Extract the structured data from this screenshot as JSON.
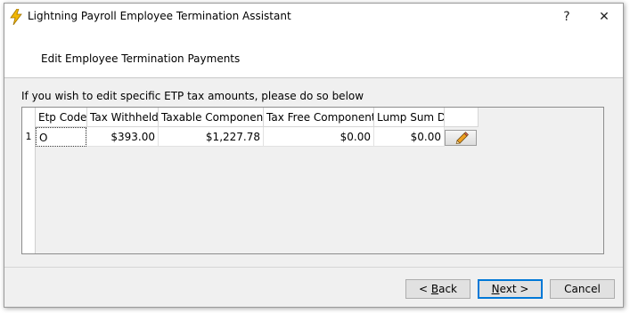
{
  "window": {
    "title": "Lightning Payroll Employee Termination Assistant",
    "help_glyph": "?",
    "close_glyph": "✕"
  },
  "header": {
    "subtitle": "Edit Employee Termination Payments"
  },
  "instruction": "If you wish to edit specific ETP tax amounts, please do so below",
  "grid": {
    "columns": [
      "Etp Code",
      "Tax Withheld",
      "Taxable Component",
      "Tax Free Component",
      "Lump Sum D"
    ],
    "rows": [
      {
        "num": "1",
        "etp_code": "O",
        "tax_withheld": "$393.00",
        "taxable_component": "$1,227.78",
        "tax_free_component": "$0.00",
        "lump_sum_d": "$0.00",
        "action_icon": "pencil-icon"
      }
    ]
  },
  "buttons": {
    "back_prefix": "< ",
    "back_hotkey": "B",
    "back_rest": "ack",
    "next_hotkey": "N",
    "next_rest": "ext >",
    "cancel": "Cancel"
  },
  "colors": {
    "accent": "#0078d7",
    "title_icon": "#f2b705"
  }
}
